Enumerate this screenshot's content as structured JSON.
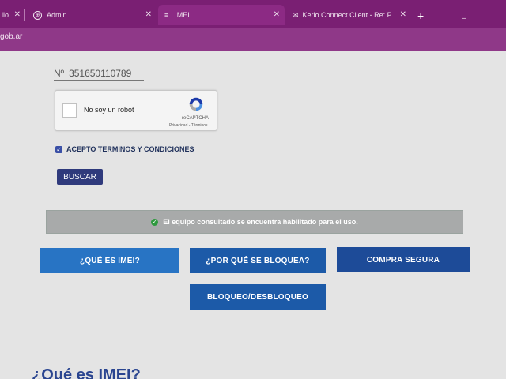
{
  "browser": {
    "tabs": [
      {
        "label": "llo",
        "icon": "",
        "active": false
      },
      {
        "label": "Admin",
        "icon": "globe-icon",
        "active": false
      },
      {
        "label": "IMEI",
        "icon": "menu-icon",
        "active": true
      },
      {
        "label": "Kerio Connect Client - Re: PEDI",
        "icon": "mail-icon",
        "active": false
      }
    ],
    "new_tab": "+",
    "minimize": "–",
    "url": "gob.ar",
    "colors": {
      "chrome": "#7a1f73",
      "toolbar": "#8f3888"
    }
  },
  "form": {
    "imei_prefix": "Nº",
    "imei_value": "351650110789",
    "captcha": {
      "label": "No soy un robot",
      "brand": "reCAPTCHA",
      "links": "Privacidad - Términos"
    },
    "terms_label": "ACEPTO TERMINOS Y CONDICIONES",
    "terms_checked": true,
    "search_button": "BUSCAR"
  },
  "result": {
    "message": "El equipo consultado se encuentra habilitado para el uso.",
    "icon": "check-circle-icon",
    "color": "#2e9a3e"
  },
  "nav_buttons": [
    {
      "label": "¿QUÉ ES IMEI?"
    },
    {
      "label": "¿POR QUÉ SE BLOQUEA?"
    },
    {
      "label": "COMPRA SEGURA"
    },
    {
      "label": "BLOQUEO/DESBLOQUEO"
    }
  ],
  "section": {
    "heading": "¿Qué es IMEI?"
  }
}
